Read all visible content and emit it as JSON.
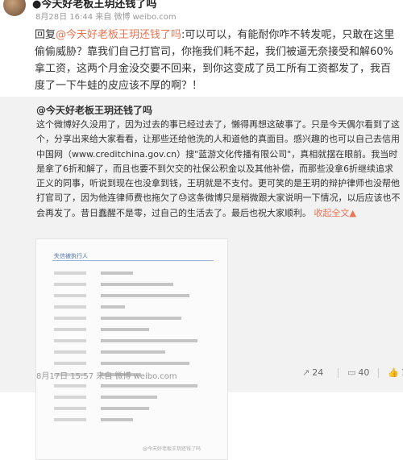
{
  "post": {
    "username": "●今天好老板王玥还钱了吗",
    "meta": "8月28日 16:44 来自 微博 weibo.com",
    "reply_prefix": "回复",
    "reply_mention": "@今天好老板王玥还钱了吗",
    "reply_body": ":可以可以，有能耐你咋不转发呢，只敢在这里偷偷威胁？靠我们自己打官司，你拖我们耗不起，我们被逼无奈接受和解60%拿工资，这两个月金没交要不回来，到你这变成了员工所有工资都发了，我百度了一下牛蛙的皮应该不厚的啊？！"
  },
  "repost": {
    "author": "@今天好老板王玥还钱了吗",
    "text_before_link": "这个微博好久没用了，因为过去的事已经过去了，懒得再想这破事了。只是今天偶尔看到了这个，分享出来给大家看看，让那些还给他洗的人和道他的真面目。感兴趣的也可以自己去信用中国网（www.creditchina.gov.cn）搜\"蓝游文化传播有限公司\"，真相就摆在眼前。我当时是拿了6折和解了，而且也要不到欠交的社保公积金以及其他补偿，而那些没拿6折继续追求正义的同事，听说到现在也没拿到钱，王玥就是不支付。更可笑的是王玥的辩护律师也没帮他打官司了，因为他连律师费也拖欠了",
    "emoji": "😓",
    "text_after_emoji": "这条微博只是稍微跟大家说明一下情况，以后应该也不会再发了。昔日蠢醒不是零，过自己的生活去了。最后也祝大家顺利。",
    "expand_label": "收起全文",
    "expand_arrow": "▲",
    "image": {
      "title": "失信被执行人",
      "watermark": "@今天好老板王玥还钱了吗"
    },
    "time": "8月17日 15:57 来自 微博 weibo.com",
    "reposts": "24",
    "comments": "40",
    "likes": "1"
  },
  "icons": {
    "repost": "repost-icon",
    "comment": "comment-icon",
    "like": "like-icon"
  }
}
